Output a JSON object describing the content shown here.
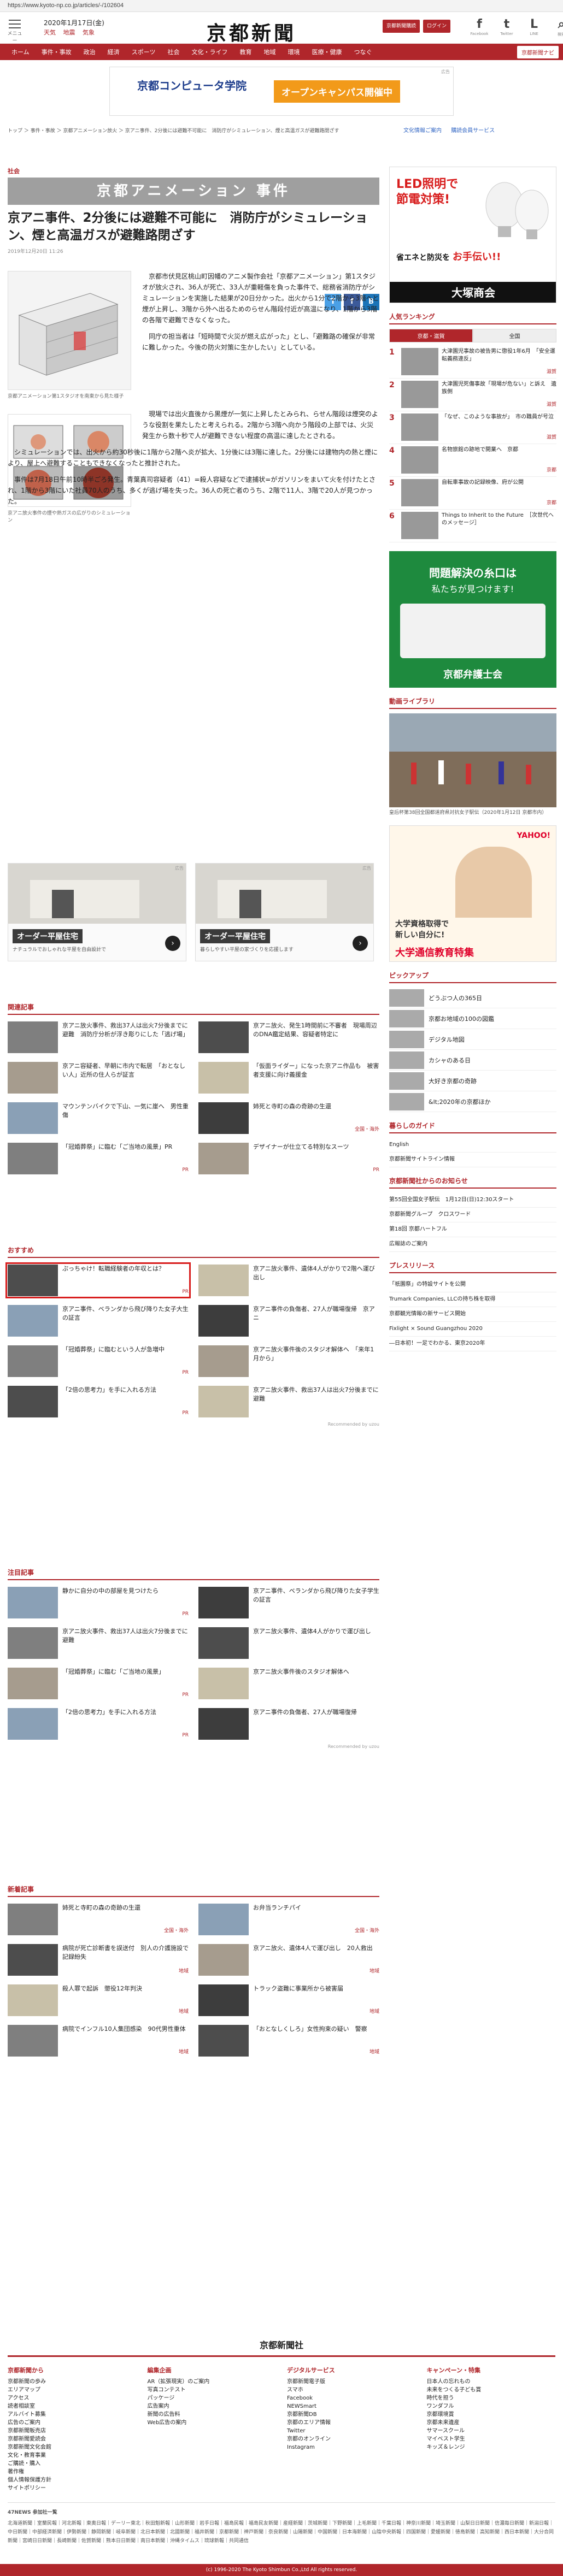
{
  "url": "https://www.kyoto-np.co.jp/articles/-/102604",
  "header": {
    "menu_label": "メニュー",
    "date": "2020年1月17日(金)",
    "weather": [
      "天気",
      "地震",
      "気象"
    ],
    "logo": "京都新聞",
    "btn_subscribe": "京都新聞購読",
    "btn_login": "ログイン",
    "social": [
      {
        "name": "facebook",
        "glyph": "f",
        "label": "Facebook"
      },
      {
        "name": "twitter",
        "glyph": "t",
        "label": "Twitter"
      },
      {
        "name": "line",
        "glyph": "L",
        "label": "LINE"
      },
      {
        "name": "search",
        "glyph": "⌕",
        "label": "検索"
      }
    ]
  },
  "nav": {
    "items": [
      "ホーム",
      "事件・事故",
      "政治",
      "経済",
      "スポーツ",
      "社会",
      "文化・ライフ",
      "教育",
      "地域",
      "環境",
      "医療・健康",
      "つなぐ"
    ],
    "kyoto": "京都新聞ナビ"
  },
  "top_ad": {
    "name": "京都コンピュータ学院",
    "cta": "オープンキャンパス開催中",
    "badge": "広告"
  },
  "breadcrumb": "トップ ＞ 事件・事故 ＞ 京都アニメーション放火 ＞ 京アニ事件、2分後には避難不可能に　消防庁がシミュレーション、煙と高温ガスが避難路閉ざす",
  "bc_links": [
    "文化情報ご案内",
    "購読会員サービス"
  ],
  "article": {
    "category": "社会",
    "banner": "京都アニメーション 事件",
    "title": "京アニ事件、2分後には避難不可能に　消防庁がシミュレーション、煙と高温ガスが避難路閉ざす",
    "date": "2019年12月20日 11:26",
    "share": [
      "T",
      "f",
      "B"
    ],
    "fig1_caption": "京都アニメーション第1スタジオを南東から見た様子",
    "fig2_caption": "京アニ放火事件の煙や熱ガスの広がりのシミュレーション",
    "p1": "京都市伏見区桃山町因幡のアニメ製作会社「京都アニメーション」第1スタジオが放火され、36人が死亡、33人が重軽傷を負った事件で、総務省消防庁がシミュレーションを実施した結果が20日分かった。出火から1分で2階から3階へと煙が上昇し、3階から外へ出るためのらせん階段付近が高温になり、1階から3階の各階で避難できなくなった。",
    "p2": "同庁の担当者は「短時間で火災が燃え広がった」とし、「避難路の確保が非常に難しかった。今後の防火対策に生かしたい」としている。",
    "p3": "現場では出火直後から黒煙が一気に上昇したとみられ、らせん階段は煙突のような役割を果たしたと考えられる。2階から3階へ向かう階段の上部では、火災発生から数十秒で人が避難できない程度の高温に達したとされる。",
    "p4": "シミュレーションでは、出火から約30秒後に1階から2階へ炎が拡大、1分後には3階に達した。2分後には建物内の熱と煙により、屋上へ避難することもできなくなったと推計された。",
    "p5": "事件は7月18日午前10時半ごろ発生。青葉真司容疑者（41）=殺人容疑などで逮捕状=がガソリンをまいて火を付けたとされ、1階から3階にいた社員70人のうち、多くが逃げ場を失った。36人の死亡者のうち、2階で11人、3階で20人が見つかった。"
  },
  "ads_mid": [
    {
      "label": "オーダー平屋住宅",
      "text": "ナチュラルでおしゃれな平屋を自由設計で",
      "badge": "広告"
    },
    {
      "label": "オーダー平屋住宅",
      "text": "暮らしやすい平屋の家づくりを応援します",
      "badge": "広告"
    }
  ],
  "related": {
    "title": "関連記事",
    "items": [
      {
        "text": "京アニ放火事件、救出37人は出火7分後までに避難　消防庁分析が浮き彫りにした「逃げ場」",
        "meta": "",
        "thumb": "t1"
      },
      {
        "text": "京アニ放火、発生1時間前に不審者　現場周辺のDNA鑑定結果、容疑者特定に",
        "meta": "",
        "thumb": "t2"
      },
      {
        "text": "京アニ容疑者、早朝に市内で転居　「おとなしい人」近所の住人らが証言",
        "meta": "",
        "thumb": "t3"
      },
      {
        "text": "「仮面ライダー」になった京アニ作品も　被害者支援に向け義援金",
        "meta": "",
        "thumb": "t4"
      },
      {
        "text": "マウンテンバイクで下山、一気に崖へ　男性重傷",
        "meta": "",
        "thumb": "t5"
      },
      {
        "text": "姉死と寺町の森の奇跡の生還",
        "meta": "全国・海外",
        "thumb": "t6"
      },
      {
        "text": "「冠婚葬祭」に臨む「ご当地の風景」PR",
        "meta": "PR",
        "thumb": "t1"
      },
      {
        "text": "デザイナーが仕立てる特別なスーツ",
        "meta": "PR",
        "thumb": "t3"
      }
    ]
  },
  "recommend": {
    "title": "おすすめ",
    "items": [
      {
        "text": "ぷっちゃけ！転職経験者の年収とは？",
        "meta": "PR",
        "thumb": "t2",
        "highlight": true
      },
      {
        "text": "京アニ放火事件、遺体4人がかりで2階へ運び出し",
        "meta": "",
        "thumb": "t4",
        "highlight": false
      },
      {
        "text": "京アニ事件、ベランダから飛び降りた女子大生の証言",
        "meta": "",
        "thumb": "t5",
        "highlight": false
      },
      {
        "text": "京アニ事件の負傷者、27人が職場復帰　京アニ",
        "meta": "",
        "thumb": "t6",
        "highlight": false
      },
      {
        "text": "「冠婚葬祭」に臨むという人が急増中",
        "meta": "PR",
        "thumb": "t1",
        "highlight": false
      },
      {
        "text": "京アニ放火事件後のスタジオ解体へ　「来年1月から」",
        "meta": "",
        "thumb": "t3",
        "highlight": false
      },
      {
        "text": "「2倍の思考力」を手に入れる方法",
        "meta": "PR",
        "thumb": "t2",
        "highlight": false
      },
      {
        "text": "京アニ放火事件、救出37人は出火7分後までに避難",
        "meta": "",
        "thumb": "t4",
        "highlight": false
      }
    ],
    "powered": "Recommended by uzou"
  },
  "attention": {
    "title": "注目記事",
    "items": [
      {
        "text": "静かに自分の中の部屋を見つけたら",
        "meta": "PR",
        "thumb": "t5"
      },
      {
        "text": "京アニ事件、ベランダから飛び降りた女子学生の証言",
        "meta": "",
        "thumb": "t6"
      },
      {
        "text": "京アニ放火事件、救出37人は出火7分後までに避難",
        "meta": "",
        "thumb": "t1"
      },
      {
        "text": "京アニ放火事件、遺体4人がかりで運び出し",
        "meta": "",
        "thumb": "t2"
      },
      {
        "text": "「冠婚葬祭」に臨む「ご当地の風景」",
        "meta": "PR",
        "thumb": "t3"
      },
      {
        "text": "京アニ放火事件後のスタジオ解体へ",
        "meta": "",
        "thumb": "t4"
      },
      {
        "text": "「2倍の思考力」を手に入れる方法",
        "meta": "PR",
        "thumb": "t5"
      },
      {
        "text": "京アニ事件の負傷者、27人が職場復帰",
        "meta": "",
        "thumb": "t6"
      }
    ],
    "powered": "Recommended by uzou"
  },
  "latest": {
    "title": "新着記事",
    "items": [
      {
        "text": "姉死と寺町の森の奇跡の生還",
        "meta": "全国・海外",
        "thumb": "t1"
      },
      {
        "text": "お弁当ランチパイ",
        "meta": "全国・海外",
        "thumb": "t5"
      },
      {
        "text": "病院が死亡診断書を誤送付　別人の介護施設で記録紛失",
        "meta": "地域",
        "thumb": "t2"
      },
      {
        "text": "京アニ放火、遺体4人で運び出し　20人救出",
        "meta": "地域",
        "thumb": "t3"
      },
      {
        "text": "殺人罪で起訴　懲役12年判決",
        "meta": "地域",
        "thumb": "t4"
      },
      {
        "text": "トラック盗難に事業所から被害届",
        "meta": "地域",
        "thumb": "t6"
      },
      {
        "text": "病院でインフル10人集団感染　90代男性重体",
        "meta": "地域",
        "thumb": "t1"
      },
      {
        "text": "「おとなしくしろ」女性拘束の疑い　警察",
        "meta": "地域",
        "thumb": "t2"
      }
    ]
  },
  "side": {
    "ad1": {
      "line1": "LED照明で",
      "line2": "節電対策!",
      "line3": "省エネと防災を",
      "line4": "お手伝い!!",
      "company": "大塚商会"
    },
    "ranking_title": "人気ランキング",
    "ranking_tabs": [
      "京都・滋賀",
      "全国"
    ],
    "ranking": [
      {
        "no": "1",
        "text": "大津園児事故の被告男に懲役1年6月　「安全運転義務違反」",
        "g": "滋賀"
      },
      {
        "no": "2",
        "text": "大津園児死傷事故「現場が危ない」と訴え　遺族側",
        "g": "滋賀"
      },
      {
        "no": "3",
        "text": "「なぜ、このような事故が」　市の職員が号泣",
        "g": "滋賀"
      },
      {
        "no": "4",
        "text": "名物旅館の跡地で開業へ　京都",
        "g": "京都"
      },
      {
        "no": "5",
        "text": "自転車事故の記録映像、府が公開",
        "g": "京都"
      },
      {
        "no": "6",
        "text": "Things to Inherit to the Future　［次世代へのメッセージ］",
        "g": ""
      }
    ],
    "ad2": {
      "line1": "問題解決の糸口は",
      "line2": "私たちが見つけます!",
      "company": "京都弁護士会"
    },
    "video_title": "動画ライブラリ",
    "video_caption": "皇后杯第38回全国都道府県対抗女子駅伝（2020年1月12日 京都市内）",
    "ad3": {
      "brand": "YAHOO!",
      "line1": "大学資格取得で",
      "line2": "新しい自分に!",
      "school": "大学通信教育特集"
    },
    "pickup_title": "ピックアップ",
    "pickup": [
      "どうぶつ人の365日",
      "京都お地域の100の図鑑",
      "デジタル地図",
      "カシャのある日",
      "大好き京都の奇跡",
      "&lt;2020年の京都ほか"
    ],
    "living_title": "暮らしのガイド",
    "living": [
      "English",
      "京都新聞サイトライン情報"
    ],
    "notice_title": "京都新聞社からのお知らせ",
    "notice": [
      "第55回全国女子駅伝　1月12日(日)12:30スタート",
      "京都新聞グループ　クロスワード",
      "第18回 京都ハートフル",
      "広報誌のご案内"
    ],
    "press_title": "プレスリリース",
    "press": [
      "「祇園祭」の特設サイトを公開",
      "Trumark Companies, LLCの持ち株を取得",
      "京都観光情報の新サービス開始",
      "Fixlight × Sound Guangzhou 2020",
      "―日本初！一足でわかる、東京2020年"
    ]
  },
  "footer": {
    "logo": "京都新聞社",
    "cols": [
      {
        "title": "京都新聞から",
        "items": [
          "京都新聞の歩み",
          "エリアマップ",
          "アクセス",
          "読者相談室",
          "アルバイト募集",
          "広告のご案内",
          "京都新聞販売店",
          "京都新聞愛読会",
          "京都新聞文化会館",
          "文化・教育事業",
          "ご購読・購入",
          "著作権",
          "個人情報保護方針",
          "サイトポリシー"
        ]
      },
      {
        "title": "編集企画",
        "items": [
          "AR（拡張現実）のご案内",
          "写真コンテスト",
          "パッケージ",
          "広告案内",
          "新聞の広告料",
          "Web広告の案内"
        ]
      },
      {
        "title": "デジタルサービス",
        "items": [
          "京都新聞電子版",
          "スマホ",
          "Facebook",
          "NEWSmart",
          "京都新聞DB",
          "京都のエリア情報",
          "Twitter",
          "京都のオンライン",
          "Instagram"
        ]
      },
      {
        "title": "キャンペーン・特集",
        "items": [
          "日本人の忘れもの",
          "未来をつくる子ども賞",
          "時代を担う",
          "ワンダフル",
          "京都環境賞",
          "京都未来遺産",
          "サマースクール",
          "マイベスト学生",
          "キッズ＆レンジ"
        ]
      }
    ],
    "net_title": "47NEWS 参加社一覧",
    "net": "北海道新聞｜室蘭民報｜河北新報｜東奥日報｜デーリー東北｜秋田魁新報｜山形新聞｜岩手日報｜福島民報｜福島民友新聞｜産経新聞｜茨城新聞｜下野新聞｜上毛新聞｜千葉日報｜神奈川新聞｜埼玉新聞｜山梨日日新聞｜信濃毎日新聞｜新潟日報｜中日新聞｜中部経済新聞｜伊勢新聞｜静岡新聞｜岐阜新聞｜北日本新聞｜北國新聞｜福井新聞｜京都新聞｜神戸新聞｜奈良新聞｜山陽新聞｜中国新聞｜日本海新聞｜山陰中央新報｜四国新聞｜愛媛新聞｜徳島新聞｜高知新聞｜西日本新聞｜大分合同新聞｜宮崎日日新聞｜長崎新聞｜佐賀新聞｜熊本日日新聞｜南日本新聞｜沖縄タイムス｜琉球新報｜共同通信",
    "copyright": "(c) 1996-2020 The Kyoto Shimbun Co.,Ltd All rights reserved."
  }
}
